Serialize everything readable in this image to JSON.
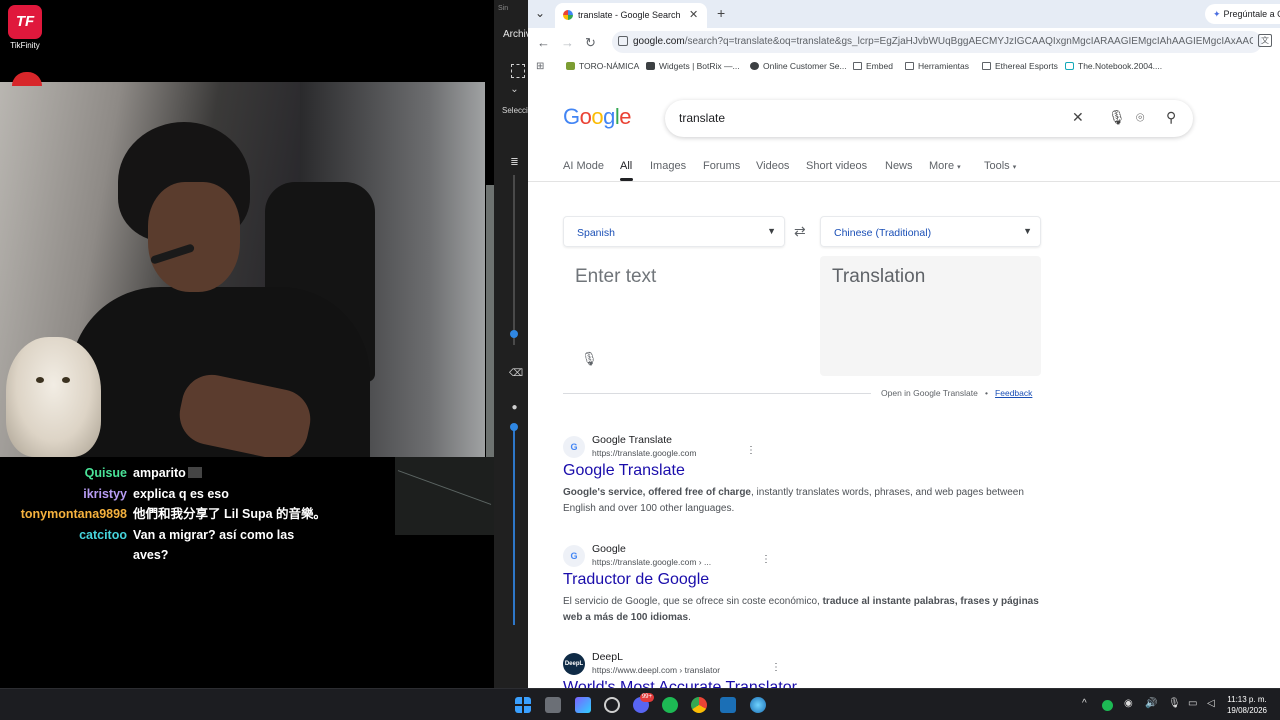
{
  "overlay": {
    "tikfinity_label": "TikFinity",
    "tikfinity_logo_text": "TF"
  },
  "chat": [
    {
      "user": "Quisue",
      "message": "amparito",
      "color": "#4ae398"
    },
    {
      "user": "ikristyy",
      "message": "explica q es eso",
      "color": "#b79cf3"
    },
    {
      "user": "tonymontana9898",
      "message": "他們和我分享了 Lil Supa 的音樂。",
      "color": "#f6b23e"
    },
    {
      "user": "catcitoo",
      "message": "Van a migrar? así como las aves?",
      "color": "#46d4dc"
    }
  ],
  "paint": {
    "tab_text": "Sin",
    "menu_archivo": "Archiv",
    "select_label": "Selecci"
  },
  "browser": {
    "tab_title": "translate - Google Search",
    "gemini_button": "Pregúntale a G",
    "url_main": "google.com",
    "url_rest": "/search?q=translate&oq=translate&gs_lcrp=EgZjaHJvbWUqBggAECMYJzIGCAAQIxgnMgcIARAAGIEMgcIAhAAGIEMgcIAxAAGIEMgcIAxAAGIEMgc...",
    "bookmarks": [
      "TORO-NÁMICA",
      "Widgets | BotRix —...",
      "Online Customer Se...",
      "Embed",
      "Herramientas",
      "Ethereal Esports",
      "The.Notebook.2004...."
    ]
  },
  "google": {
    "logo": [
      "G",
      "o",
      "o",
      "g",
      "l",
      "e"
    ],
    "search_query": "translate",
    "tabs": [
      "AI Mode",
      "All",
      "Images",
      "Forums",
      "Videos",
      "Short videos",
      "News",
      "More",
      "Tools"
    ],
    "active_tab": "All"
  },
  "translator": {
    "source_lang": "Spanish",
    "target_lang": "Chinese (Traditional)",
    "source_placeholder": "Enter text",
    "target_placeholder": "Translation",
    "open_in_translate": "Open in Google Translate",
    "separator": "•",
    "feedback": "Feedback"
  },
  "results": [
    {
      "site": "Google Translate",
      "url": "https://translate.google.com",
      "title": "Google Translate",
      "snippet_bold": "Google's service, offered free of charge",
      "snippet_rest": ", instantly translates words, phrases, and web pages between English and over 100 other languages."
    },
    {
      "site": "Google",
      "url": "https://translate.google.com › ...",
      "title": "Traductor de Google",
      "snippet_pre": "El servicio de Google, que se ofrece sin coste económico, ",
      "snippet_bold": "traduce al instante palabras, frases y páginas web a más de 100 idiomas",
      "snippet_post": "."
    },
    {
      "site": "DeepL",
      "url": "https://www.deepl.com › translator",
      "title": "World's Most Accurate Translator"
    }
  ],
  "taskbar": {
    "time": "11:13 p. m.",
    "date": "19/08/2026",
    "badge": "99+"
  }
}
